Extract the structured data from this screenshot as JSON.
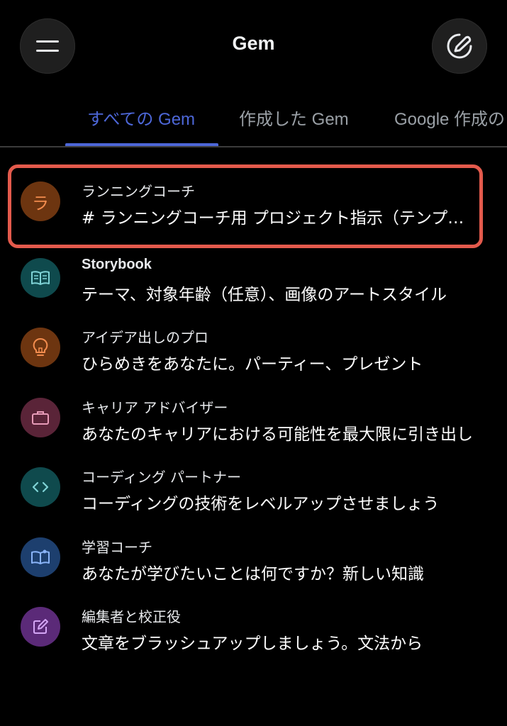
{
  "header": {
    "title": "Gem",
    "menu_icon": "menu-icon",
    "new_icon": "edit-icon"
  },
  "tabs": [
    {
      "label": "すべての Gem",
      "active": true
    },
    {
      "label": "作成した Gem",
      "active": false
    },
    {
      "label": "Google 作成の",
      "active": false
    }
  ],
  "colors": {
    "accent": "#4d67d8",
    "highlight": "#e35a4c"
  },
  "gems": [
    {
      "name": "ランニングコーチ",
      "description": "# ランニングコーチ用 プロジェクト指示（テンプレート）",
      "icon": "letter-ra",
      "avatar_letter": "ラ",
      "color": "#6d3510",
      "fg": "#f28c4e"
    },
    {
      "name": "Storybook",
      "description": "テーマ、対象年齢（任意）、画像のアートスタイル",
      "icon": "book-icon",
      "color": "#0f4a4d",
      "fg": "#7fd3d6"
    },
    {
      "name": "アイデア出しのプロ",
      "description": "ひらめきをあなたに。パーティー、プレゼント",
      "icon": "lightbulb-icon",
      "color": "#6d3510",
      "fg": "#f28c4e"
    },
    {
      "name": "キャリア アドバイザー",
      "description": "あなたのキャリアにおける可能性を最大限に引き出し",
      "icon": "briefcase-icon",
      "color": "#5a2438",
      "fg": "#e79bb7"
    },
    {
      "name": "コーディング パートナー",
      "description": "コーディングの技術をレベルアップさせましょう",
      "icon": "code-icon",
      "color": "#0f4a4d",
      "fg": "#7fd3d6"
    },
    {
      "name": "学習コーチ",
      "description": "あなたが学びたいことは何ですか？新しい知識",
      "icon": "reading-icon",
      "color": "#1d3f6e",
      "fg": "#8ab4f8"
    },
    {
      "name": "編集者と校正役",
      "description": "文章をブラッシュアップしましょう。文法から",
      "icon": "edit-note-icon",
      "color": "#5b2a78",
      "fg": "#d4a5f5"
    }
  ]
}
